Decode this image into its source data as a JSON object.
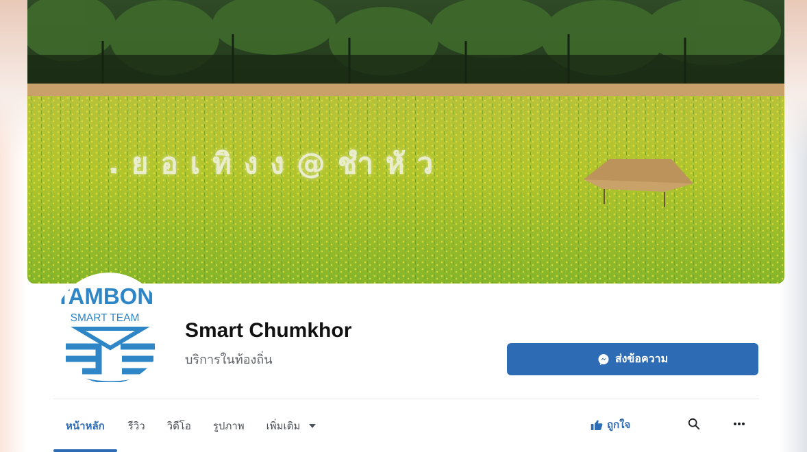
{
  "cover": {
    "overlay_text": ".ยอเทิงง@ชำหัว"
  },
  "profile": {
    "logo_line1": "TAMBON",
    "logo_line2": "SMART TEAM",
    "name": "Smart Chumkhor",
    "category": "บริการในท้องถิ่น"
  },
  "actions": {
    "message_label": "ส่งข้อความ",
    "like_label": "ถูกใจ"
  },
  "tabs": [
    {
      "label": "หน้าหลัก",
      "active": true
    },
    {
      "label": "รีวิว",
      "active": false
    },
    {
      "label": "วิดีโอ",
      "active": false
    },
    {
      "label": "รูปภาพ",
      "active": false
    },
    {
      "label": "เพิ่มเติม",
      "active": false
    }
  ],
  "icons": {
    "message": "messenger-icon",
    "like": "thumbs-up-icon",
    "search": "search-icon",
    "more": "more-options-icon",
    "dropdown": "caret-down-icon"
  },
  "colors": {
    "accent": "#2d6bb5",
    "logo_blue": "#2f86c6"
  }
}
